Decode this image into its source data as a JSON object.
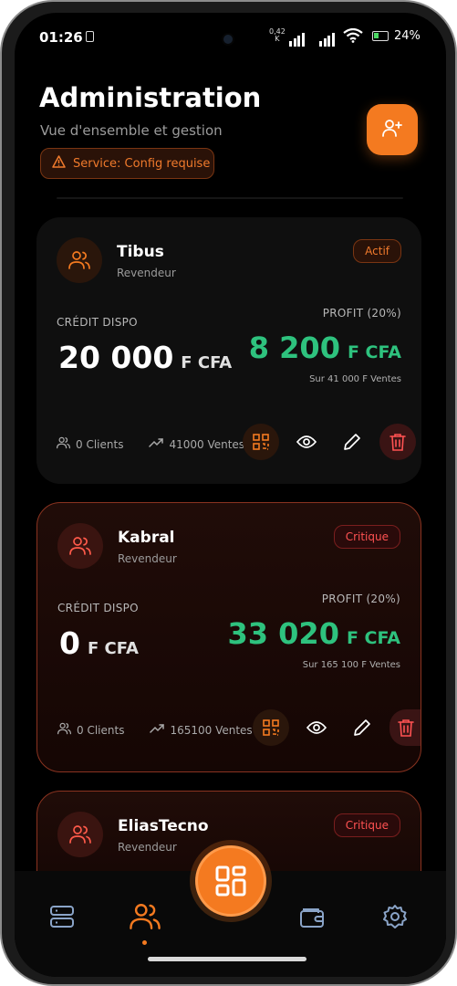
{
  "status_bar": {
    "time": "01:26",
    "net_speed_value": "0,42",
    "net_speed_unit": "K",
    "battery": "24%"
  },
  "header": {
    "title": "Administration",
    "subtitle": "Vue d'ensemble et gestion",
    "service_badge": "Service: Config requise"
  },
  "resellers": [
    {
      "name": "Tibus",
      "role": "Revendeur",
      "status": "Actif",
      "credit_label": "CRÉDIT DISPO",
      "credit_value": "20 000",
      "credit_currency": "F CFA",
      "profit_label": "PROFIT (20%)",
      "profit_value": "8 200",
      "profit_currency": "F CFA",
      "profit_sub": "Sur 41 000 F Ventes",
      "clients": "0 Clients",
      "sales": "41000 Ventes"
    },
    {
      "name": "Kabral",
      "role": "Revendeur",
      "status": "Critique",
      "credit_label": "CRÉDIT DISPO",
      "credit_value": "0",
      "credit_currency": "F CFA",
      "profit_label": "PROFIT (20%)",
      "profit_value": "33 020",
      "profit_currency": "F CFA",
      "profit_sub": "Sur 165 100 F Ventes",
      "clients": "0 Clients",
      "sales": "165100 Ventes"
    },
    {
      "name": "EliasTecno",
      "role": "Revendeur",
      "status": "Critique"
    }
  ],
  "colors": {
    "accent": "#f47a20",
    "profit": "#2ec27e",
    "critical": "#ff5252",
    "background": "#000000"
  },
  "nav": {
    "items": [
      "server-icon",
      "users-icon",
      "dashboard-icon",
      "wallet-icon",
      "settings-icon"
    ],
    "active": "users-icon"
  }
}
